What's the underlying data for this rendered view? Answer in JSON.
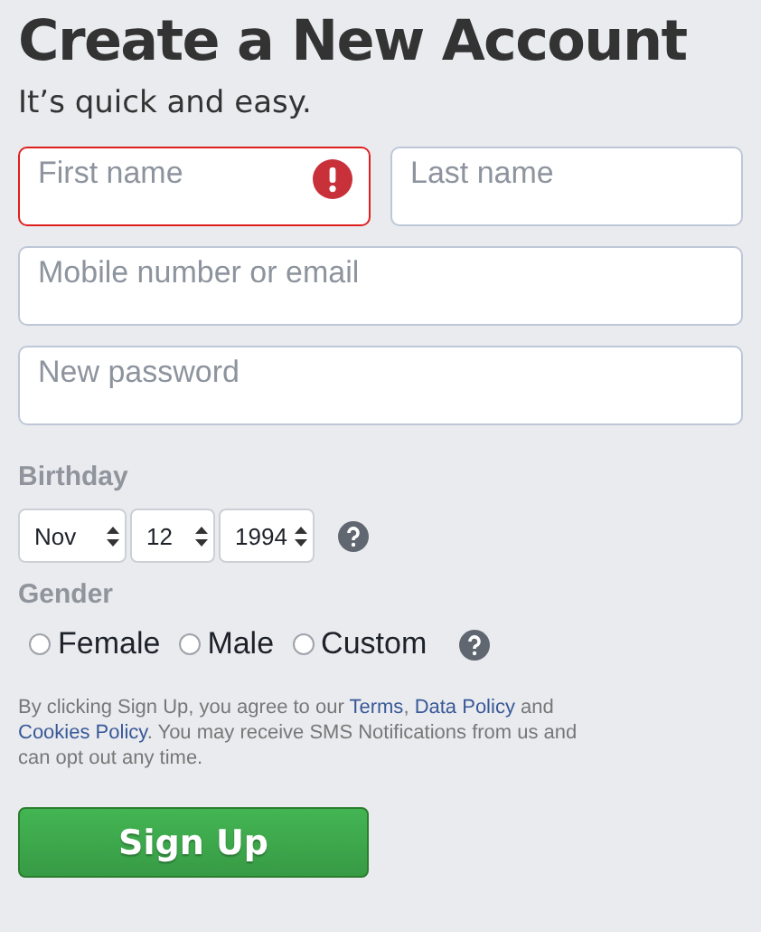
{
  "title": "Create a New Account",
  "subtitle": "It’s quick and easy.",
  "name_fields": [
    {
      "placeholder": "First name",
      "error": true
    },
    {
      "placeholder": "Last name",
      "error": false
    }
  ],
  "fields": [
    {
      "placeholder": "Mobile number or email",
      "error": false
    },
    {
      "placeholder": "New password",
      "error": false
    }
  ],
  "birthday": {
    "label": "Birthday",
    "selects": [
      {
        "value": "Nov"
      },
      {
        "value": "12"
      },
      {
        "value": "1994"
      }
    ]
  },
  "gender": {
    "label": "Gender",
    "options": [
      {
        "label": "Female",
        "selected": false
      },
      {
        "label": "Male",
        "selected": false
      },
      {
        "label": "Custom",
        "selected": false
      }
    ]
  },
  "terms": [
    {
      "kind": "text",
      "text": "By clicking Sign Up, you agree to our "
    },
    {
      "kind": "link",
      "text": "Terms"
    },
    {
      "kind": "text",
      "text": ", "
    },
    {
      "kind": "link",
      "text": "Data Policy"
    },
    {
      "kind": "text",
      "text": " and "
    },
    {
      "kind": "link",
      "text": "Cookies Policy"
    },
    {
      "kind": "text",
      "text": ". You may receive SMS Notifications from us and can opt out any time."
    }
  ],
  "button": "Sign Up"
}
